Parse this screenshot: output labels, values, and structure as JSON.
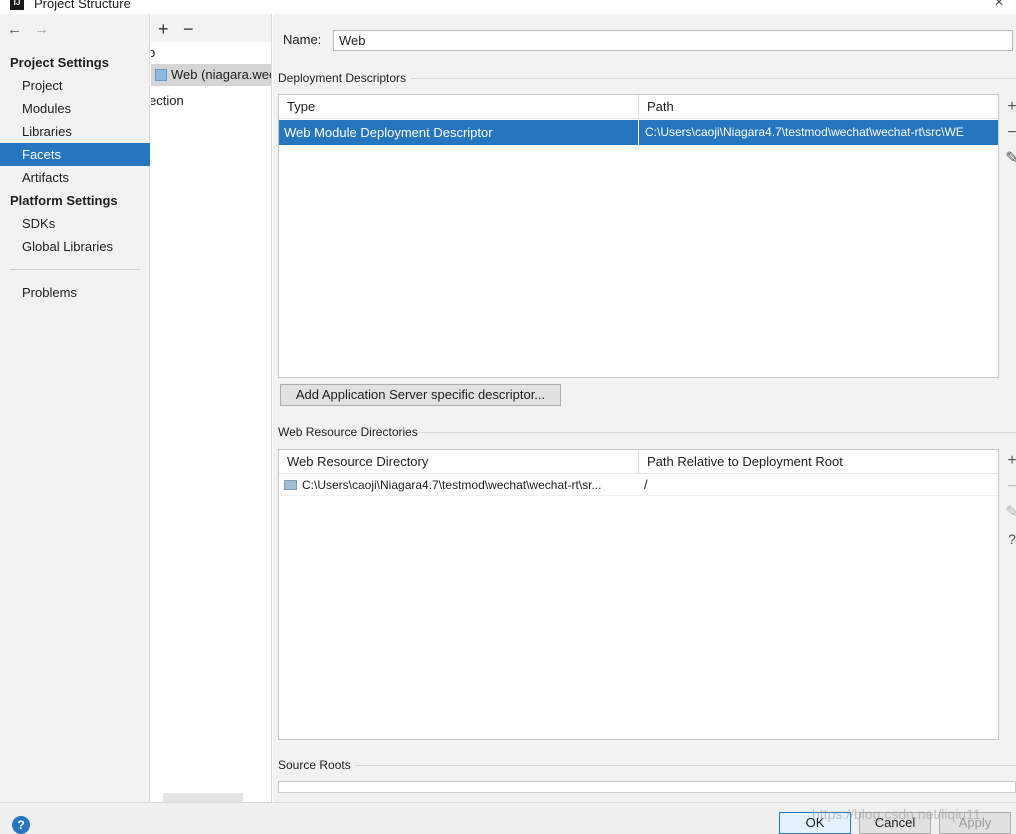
{
  "window": {
    "title": "Project Structure",
    "logo": "IJ",
    "close": "×"
  },
  "nav": {
    "back": "←",
    "forward": "→"
  },
  "sidebar": {
    "section1": "Project Settings",
    "items1": [
      "Project",
      "Modules",
      "Libraries",
      "Facets",
      "Artifacts"
    ],
    "section2": "Platform Settings",
    "items2": [
      "SDKs",
      "Global Libraries"
    ],
    "problems": "Problems",
    "selected": "Facets"
  },
  "tree": {
    "add": "+",
    "remove": "−",
    "nodes": [
      "b",
      "Web (niagara.wec",
      "ection"
    ]
  },
  "facet": {
    "name_label": "Name:",
    "name_value": "Web",
    "deployment": {
      "title": "Deployment Descriptors",
      "columns": [
        "Type",
        "Path"
      ],
      "rows": [
        {
          "type": "Web Module Deployment Descriptor",
          "path": "C:\\Users\\caoji\\Niagara4.7\\testmod\\wechat\\wechat-rt\\src\\WE"
        }
      ],
      "add_button": "Add Application Server specific descriptor..."
    },
    "resources": {
      "title": "Web Resource Directories",
      "columns": [
        "Web Resource Directory",
        "Path Relative to Deployment Root"
      ],
      "rows": [
        {
          "dir": "C:\\Users\\caoji\\Niagara4.7\\testmod\\wechat\\wechat-rt\\sr...",
          "path": "/"
        }
      ]
    },
    "source_roots": {
      "title": "Source Roots"
    }
  },
  "tools": {
    "add": "+",
    "remove": "−",
    "edit": "✎",
    "help": "?"
  },
  "footer": {
    "ok": "OK",
    "cancel": "Cancel",
    "apply": "Apply",
    "help": "?"
  },
  "watermark": "https://blog.csdn.net/liqiu11"
}
